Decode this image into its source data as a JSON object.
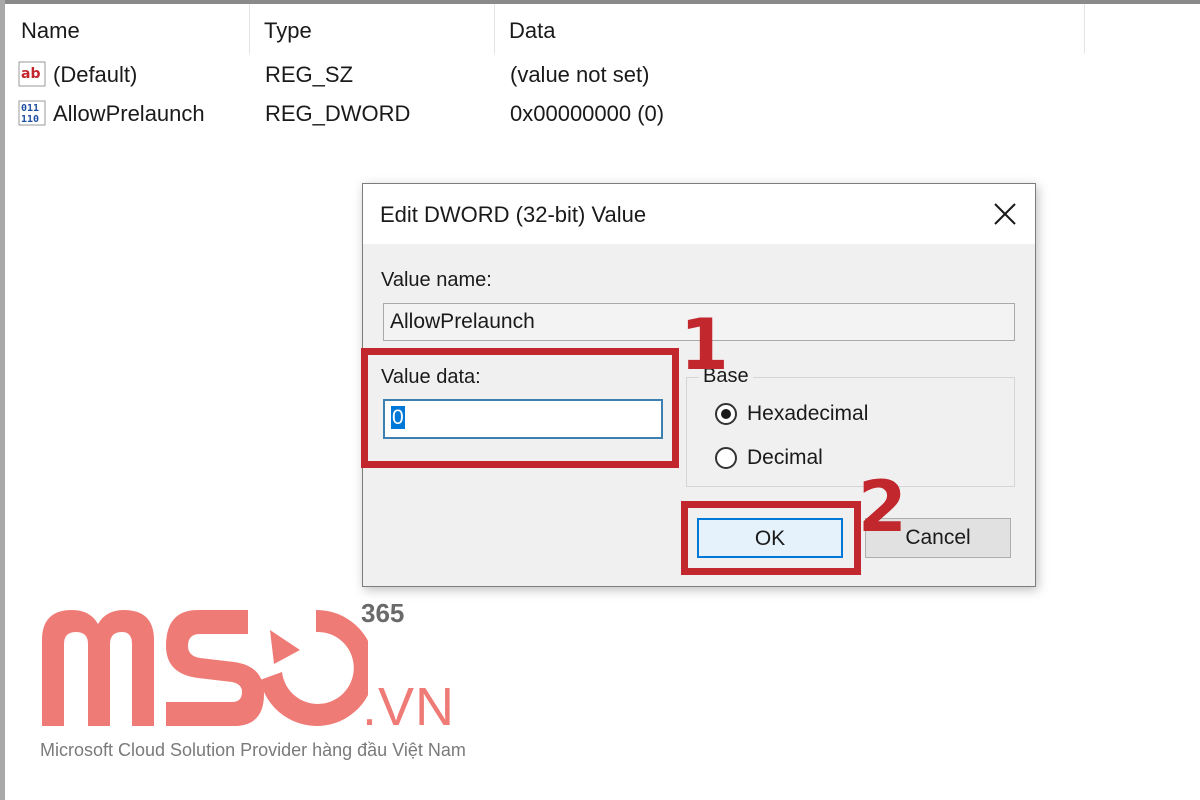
{
  "registry": {
    "columns": [
      "Name",
      "Type",
      "Data"
    ],
    "rows": [
      {
        "icon": "string-value-icon",
        "name": "(Default)",
        "type": "REG_SZ",
        "data": "(value not set)"
      },
      {
        "icon": "binary-value-icon",
        "name": "AllowPrelaunch",
        "type": "REG_DWORD",
        "data": "0x00000000 (0)"
      }
    ]
  },
  "dialog": {
    "title": "Edit DWORD (32-bit) Value",
    "value_name_label": "Value name:",
    "value_name": "AllowPrelaunch",
    "value_data_label": "Value data:",
    "value_data": "0",
    "base_label": "Base",
    "base_options": [
      {
        "label": "Hexadecimal",
        "checked": true
      },
      {
        "label": "Decimal",
        "checked": false
      }
    ],
    "ok_label": "OK",
    "cancel_label": "Cancel"
  },
  "annotations": {
    "step1": "1",
    "step2": "2",
    "color": "#c1272d"
  },
  "watermark": {
    "brand_text": "MSO",
    "superscript": "365",
    "domain_suffix": ".VN",
    "tagline": "Microsoft Cloud Solution Provider hàng đầu Việt Nam",
    "color": "#ef7b76"
  }
}
